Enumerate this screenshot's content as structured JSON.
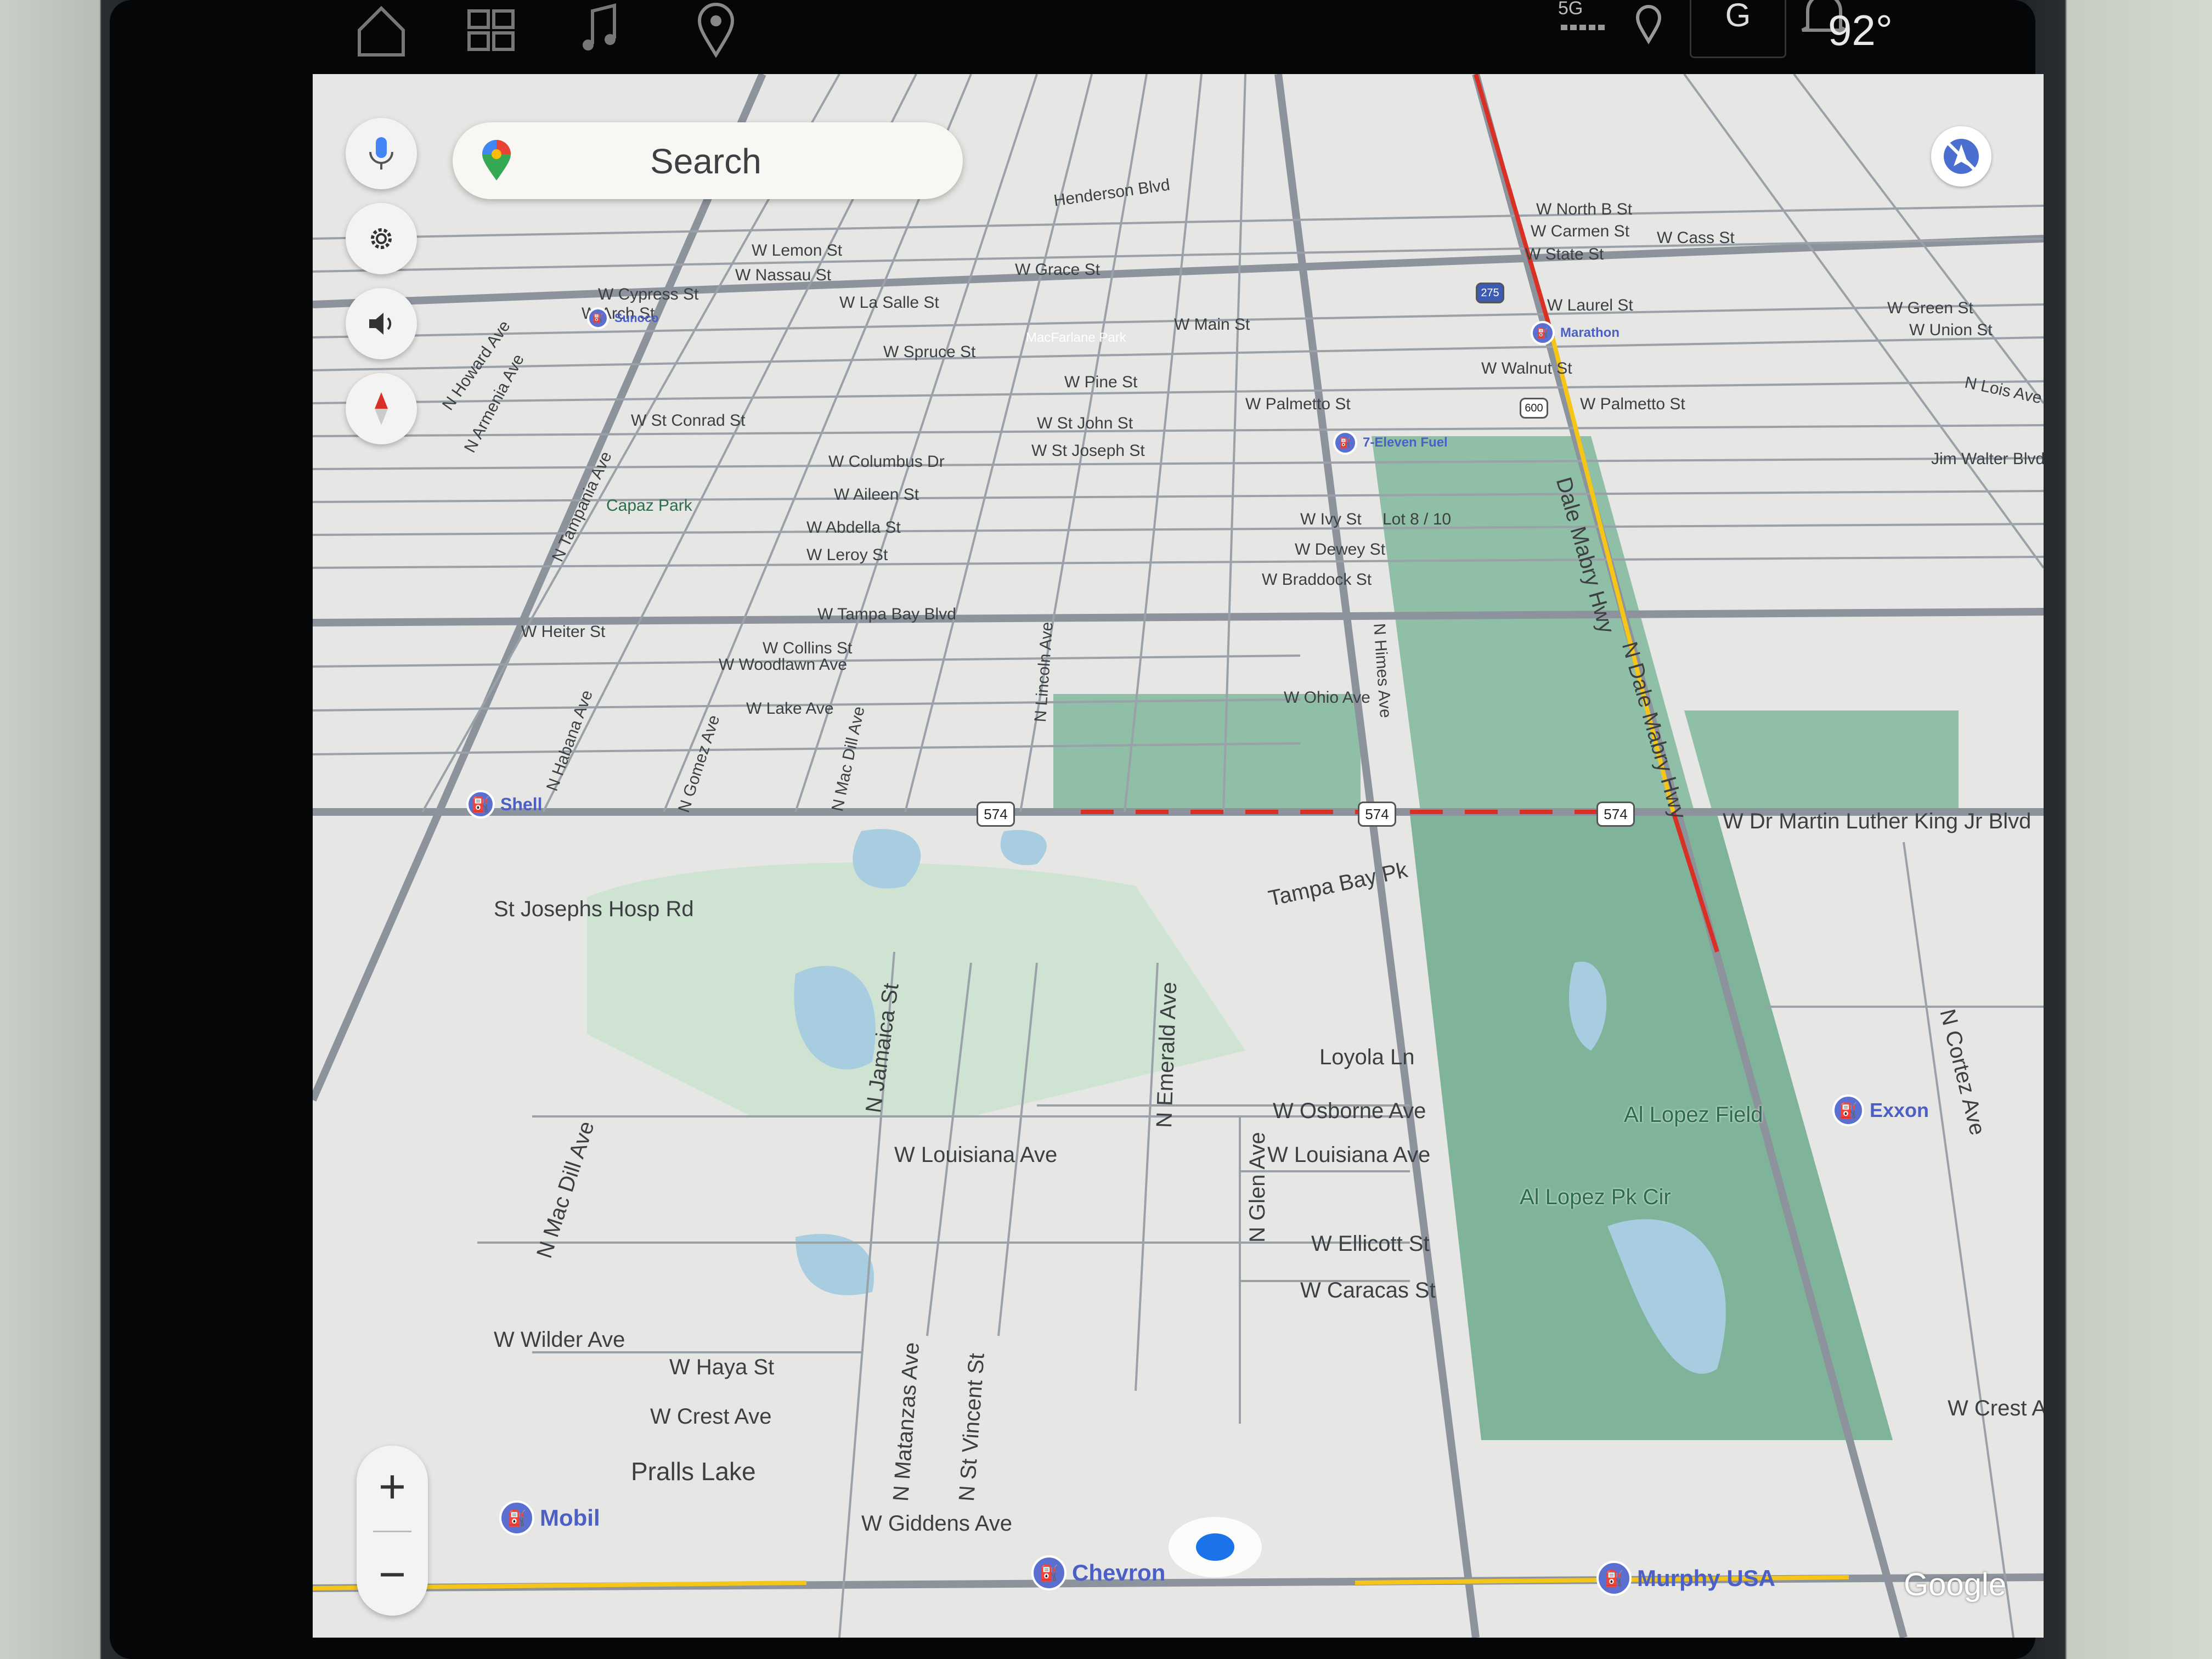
{
  "status_bar": {
    "network": "5G",
    "profile_initial": "G",
    "temperature": "92°",
    "icons": [
      "home-icon",
      "apps-grid-icon",
      "music-note-icon",
      "location-pin-icon",
      "signal-icon",
      "location-icon",
      "bell-icon"
    ]
  },
  "search": {
    "placeholder": "Search"
  },
  "controls": {
    "zoom_in": "+",
    "zoom_out": "−",
    "side_buttons": [
      "mic-icon",
      "gear-icon",
      "volume-icon",
      "compass-icon"
    ]
  },
  "map": {
    "colors": {
      "road": "#8c939c",
      "park": "#8fbfa6",
      "water": "#a9cde0",
      "traffic_red": "#d93025",
      "traffic_yellow": "#f5c518",
      "poi": "#5b6fd0"
    },
    "streets": [
      "W Cypress St",
      "W Arch St",
      "W La Salle St",
      "W Main St",
      "W Spruce St",
      "W Pine St",
      "W St Conrad St",
      "W St John St",
      "W St Joseph St",
      "W Columbus Dr",
      "W Aileen St",
      "W Abdella St",
      "W Leroy St",
      "W Tampa Bay Blvd",
      "W Heiter St",
      "W Collins St",
      "W Woodlawn Ave",
      "W Lake Ave",
      "W Ohio Ave",
      "W Ivy St",
      "W Dewey St",
      "W Braddock St",
      "W Dr Martin Luther King Jr Blvd",
      "St Josephs Hosp Rd",
      "Tampa Bay Pk",
      "Loyola Ln",
      "W Osborne Ave",
      "W Louisiana Ave",
      "W Ellicott St",
      "W Caracas St",
      "W Wilder Ave",
      "W Haya St",
      "W Crest Ave",
      "W Giddens Ave",
      "N Habana Ave",
      "N Gomez Ave",
      "N Mac Dill Ave",
      "N Lincoln Ave",
      "N Himes Ave",
      "Dale Mabry Hwy",
      "N Dale Mabry Hwy",
      "N Jamaica St",
      "N Emerald Ave",
      "N Glen Ave",
      "N Matanzas Ave",
      "N St Vincent St",
      "N Cortez Ave",
      "W Palmetto St",
      "W Laurel St",
      "W Walnut St",
      "Jim Walter Blvd",
      "N Lois Ave",
      "W Cass St",
      "W State St",
      "W Lemon St",
      "W Nassau St",
      "W Grace St",
      "Henderson Blvd",
      "W Green St",
      "W Union St",
      "W Carmen St",
      "W North B St",
      "N Armenia Ave",
      "N Tampania Ave",
      "N Howard Ave",
      "W Crest Av"
    ],
    "places": [
      "Al Lopez Field",
      "Al Lopez Pk Cir",
      "Pralls Lake",
      "Capaz Park",
      "MacFarlane Park",
      "Lot 8 / 10"
    ],
    "pois": [
      "Shell",
      "Mobil",
      "Chevron",
      "Murphy USA",
      "Exxon",
      "7-Eleven Fuel",
      "Marathon",
      "Sunoco"
    ],
    "route_shields": [
      "574",
      "574",
      "574",
      "600",
      "275"
    ],
    "attribution": "Google"
  }
}
